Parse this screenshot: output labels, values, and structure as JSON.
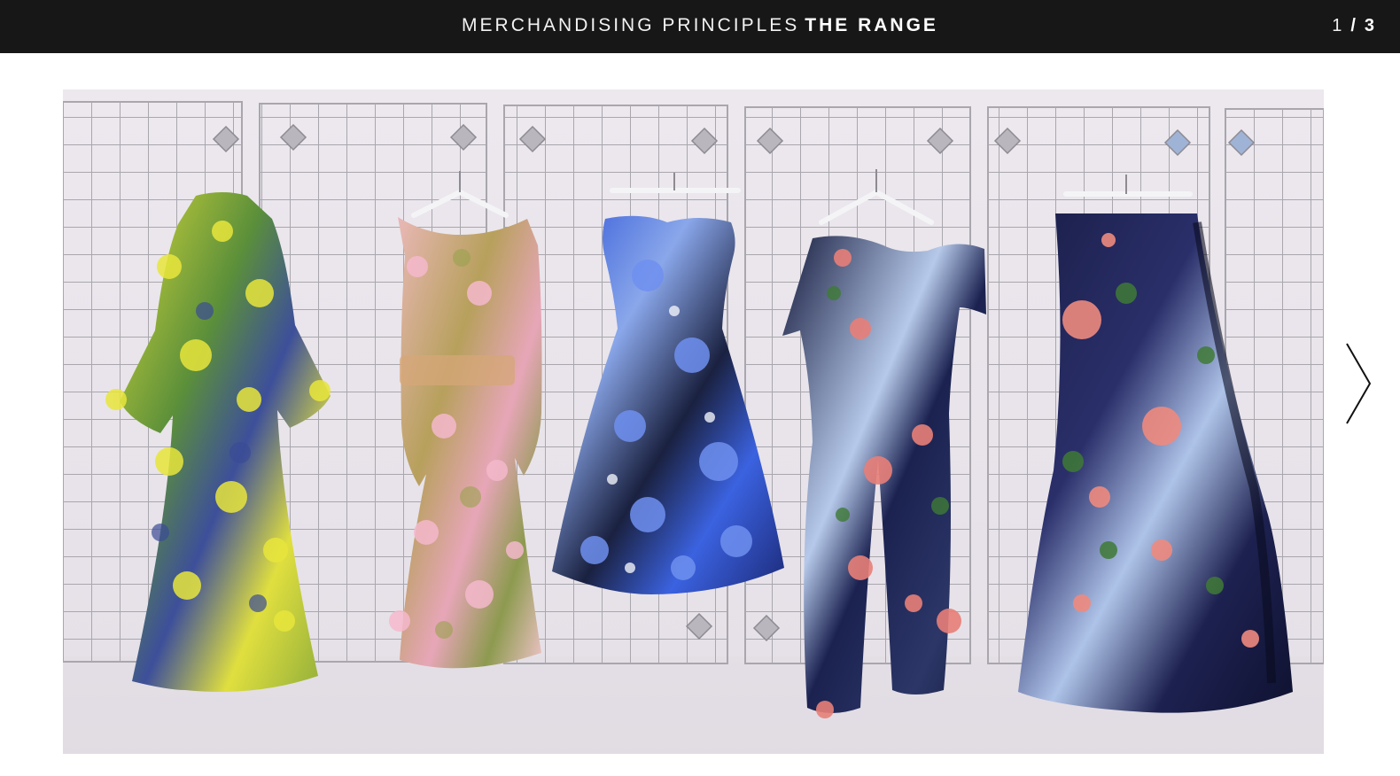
{
  "header": {
    "title_light": "MERCHANDISING PRINCIPLES",
    "title_bold": "THE RANGE",
    "counter_current": "1",
    "counter_separator": "/",
    "counter_total": "3"
  },
  "gallery": {
    "image_alt": "Five floral garments on hangers displayed against a wire grid wall",
    "next_icon": "chevron-right-icon"
  },
  "colors": {
    "header_bg": "#171717",
    "header_text": "#ffffff",
    "page_bg": "#ffffff"
  }
}
